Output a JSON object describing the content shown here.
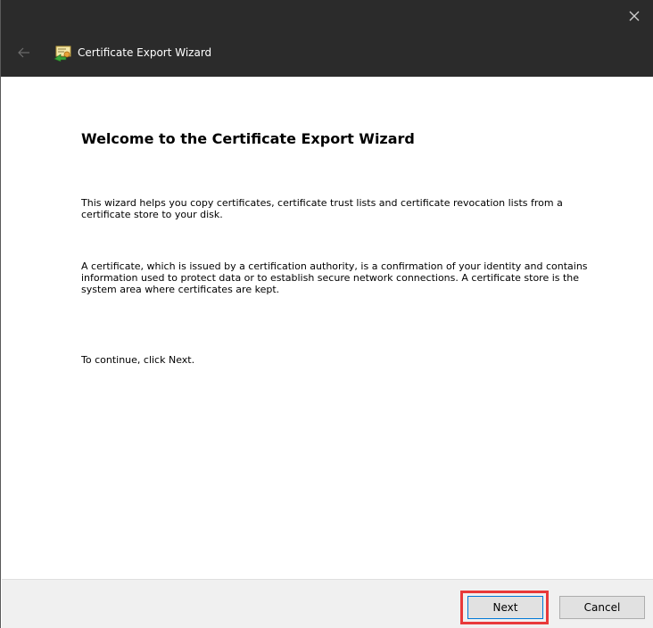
{
  "window": {
    "title": "Certificate Export Wizard",
    "icons": {
      "close": "close-icon",
      "back": "back-arrow-icon",
      "app": "certificate-icon"
    }
  },
  "content": {
    "heading": "Welcome to the Certificate Export Wizard",
    "paragraph1": "This wizard helps you copy certificates, certificate trust lists and certificate revocation lists from a certificate store to your disk.",
    "paragraph2": "A certificate, which is issued by a certification authority, is a confirmation of your identity and contains information used to protect data or to establish secure network connections. A certificate store is the system area where certificates are kept.",
    "paragraph3": "To continue, click Next."
  },
  "footer": {
    "next_label": "Next",
    "cancel_label": "Cancel"
  },
  "colors": {
    "titlebar": "#2b2b2b",
    "footer": "#f0f0f0",
    "highlight": "#e8393a",
    "button_focus": "#0078d7"
  }
}
